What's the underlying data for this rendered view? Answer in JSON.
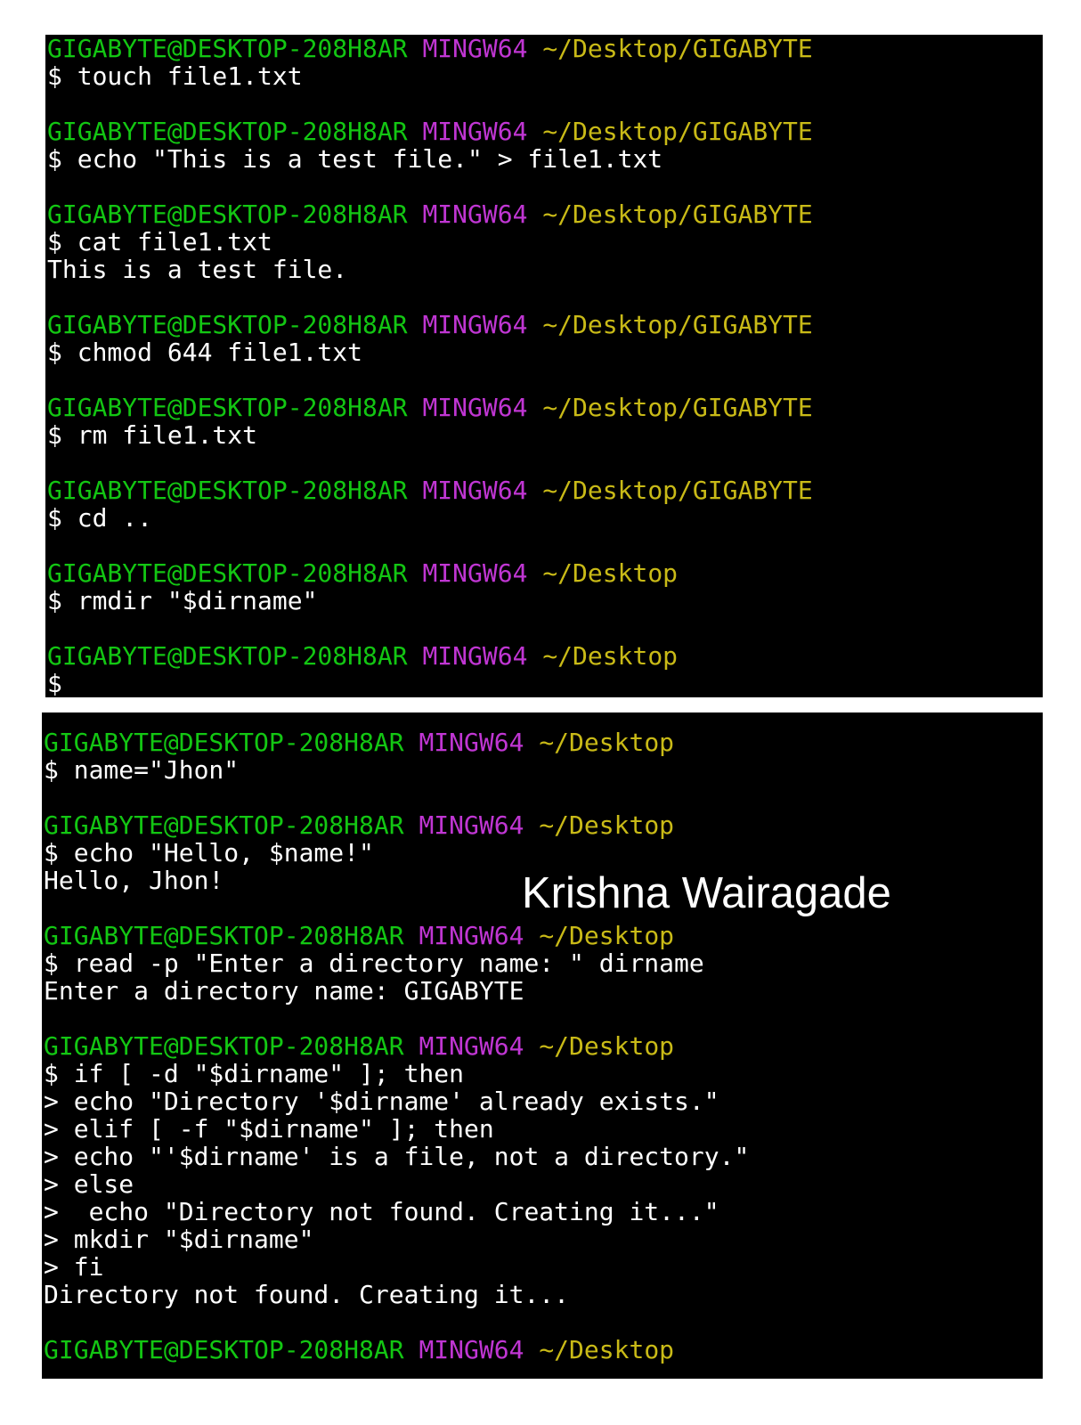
{
  "colors": {
    "background": "#000000",
    "user_host": "#13c613",
    "mingw": "#c036d3",
    "path": "#c9ba17",
    "text": "#ffffff"
  },
  "overlay_name": "Krishna Wairagade",
  "terminal_1": {
    "lines": [
      {
        "type": "prompt",
        "user": "GIGABYTE@DESKTOP-208H8AR",
        "sys": "MINGW64",
        "path": "~/Desktop/GIGABYTE"
      },
      {
        "type": "text",
        "text": "$ touch file1.txt"
      },
      {
        "type": "blank"
      },
      {
        "type": "prompt",
        "user": "GIGABYTE@DESKTOP-208H8AR",
        "sys": "MINGW64",
        "path": "~/Desktop/GIGABYTE"
      },
      {
        "type": "text",
        "text": "$ echo \"This is a test file.\" > file1.txt"
      },
      {
        "type": "blank"
      },
      {
        "type": "prompt",
        "user": "GIGABYTE@DESKTOP-208H8AR",
        "sys": "MINGW64",
        "path": "~/Desktop/GIGABYTE"
      },
      {
        "type": "text",
        "text": "$ cat file1.txt"
      },
      {
        "type": "text",
        "text": "This is a test file."
      },
      {
        "type": "blank"
      },
      {
        "type": "prompt",
        "user": "GIGABYTE@DESKTOP-208H8AR",
        "sys": "MINGW64",
        "path": "~/Desktop/GIGABYTE"
      },
      {
        "type": "text",
        "text": "$ chmod 644 file1.txt"
      },
      {
        "type": "blank"
      },
      {
        "type": "prompt",
        "user": "GIGABYTE@DESKTOP-208H8AR",
        "sys": "MINGW64",
        "path": "~/Desktop/GIGABYTE"
      },
      {
        "type": "text",
        "text": "$ rm file1.txt"
      },
      {
        "type": "blank"
      },
      {
        "type": "prompt",
        "user": "GIGABYTE@DESKTOP-208H8AR",
        "sys": "MINGW64",
        "path": "~/Desktop/GIGABYTE"
      },
      {
        "type": "text",
        "text": "$ cd .."
      },
      {
        "type": "blank"
      },
      {
        "type": "prompt",
        "user": "GIGABYTE@DESKTOP-208H8AR",
        "sys": "MINGW64",
        "path": "~/Desktop"
      },
      {
        "type": "text",
        "text": "$ rmdir \"$dirname\""
      },
      {
        "type": "blank"
      },
      {
        "type": "prompt",
        "user": "GIGABYTE@DESKTOP-208H8AR",
        "sys": "MINGW64",
        "path": "~/Desktop"
      },
      {
        "type": "text",
        "text": "$"
      }
    ]
  },
  "terminal_2": {
    "lines": [
      {
        "type": "prompt",
        "user": "GIGABYTE@DESKTOP-208H8AR",
        "sys": "MINGW64",
        "path": "~/Desktop"
      },
      {
        "type": "text",
        "text": "$ name=\"Jhon\""
      },
      {
        "type": "blank"
      },
      {
        "type": "prompt",
        "user": "GIGABYTE@DESKTOP-208H8AR",
        "sys": "MINGW64",
        "path": "~/Desktop"
      },
      {
        "type": "text",
        "text": "$ echo \"Hello, $name!\""
      },
      {
        "type": "text",
        "text": "Hello, Jhon!"
      },
      {
        "type": "blank"
      },
      {
        "type": "prompt",
        "user": "GIGABYTE@DESKTOP-208H8AR",
        "sys": "MINGW64",
        "path": "~/Desktop"
      },
      {
        "type": "text",
        "text": "$ read -p \"Enter a directory name: \" dirname"
      },
      {
        "type": "text",
        "text": "Enter a directory name: GIGABYTE"
      },
      {
        "type": "blank"
      },
      {
        "type": "prompt",
        "user": "GIGABYTE@DESKTOP-208H8AR",
        "sys": "MINGW64",
        "path": "~/Desktop"
      },
      {
        "type": "text",
        "text": "$ if [ -d \"$dirname\" ]; then"
      },
      {
        "type": "text",
        "text": "> echo \"Directory '$dirname' already exists.\""
      },
      {
        "type": "text",
        "text": "> elif [ -f \"$dirname\" ]; then"
      },
      {
        "type": "text",
        "text": "> echo \"'$dirname' is a file, not a directory.\""
      },
      {
        "type": "text",
        "text": "> else"
      },
      {
        "type": "text",
        "text": ">  echo \"Directory not found. Creating it...\""
      },
      {
        "type": "text",
        "text": "> mkdir \"$dirname\""
      },
      {
        "type": "text",
        "text": "> fi"
      },
      {
        "type": "text",
        "text": "Directory not found. Creating it..."
      },
      {
        "type": "blank"
      },
      {
        "type": "prompt",
        "user": "GIGABYTE@DESKTOP-208H8AR",
        "sys": "MINGW64",
        "path": "~/Desktop"
      }
    ]
  }
}
